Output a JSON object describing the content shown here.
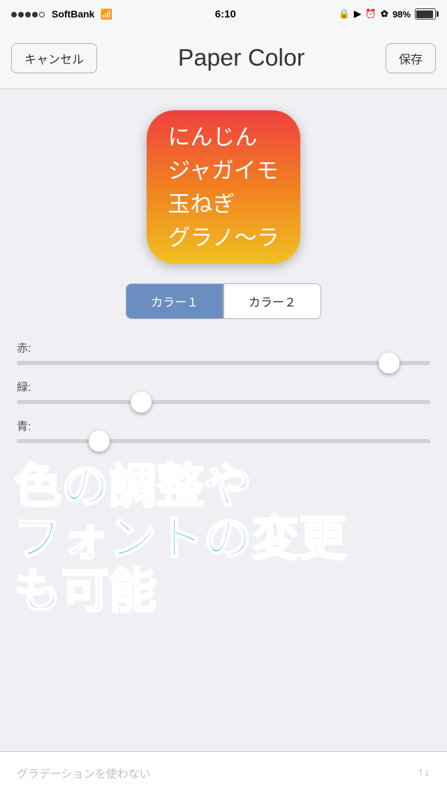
{
  "statusBar": {
    "carrier": "SoftBank",
    "time": "6:10",
    "battery": "98%"
  },
  "navBar": {
    "cancelLabel": "キャンセル",
    "title": "Paper Color",
    "saveLabel": "保存"
  },
  "appIcon": {
    "lines": [
      "にんじん",
      "ジャガイモ",
      "玉ねぎ",
      "グラノ～ラ"
    ]
  },
  "segmentedControl": {
    "option1": "カラー１",
    "option2": "カラー２"
  },
  "sliders": {
    "redLabel": "赤:",
    "greenLabel": "緑:",
    "blueLabel": "青:",
    "redValue": 90,
    "greenValue": 30,
    "blueValue": 20
  },
  "overlayText": {
    "line1": "色の調整や",
    "line2": "フォントの変更",
    "line3": "も可能"
  },
  "bottomBar": {
    "label": "グラデーションを使わない",
    "icon": "↑↓"
  }
}
